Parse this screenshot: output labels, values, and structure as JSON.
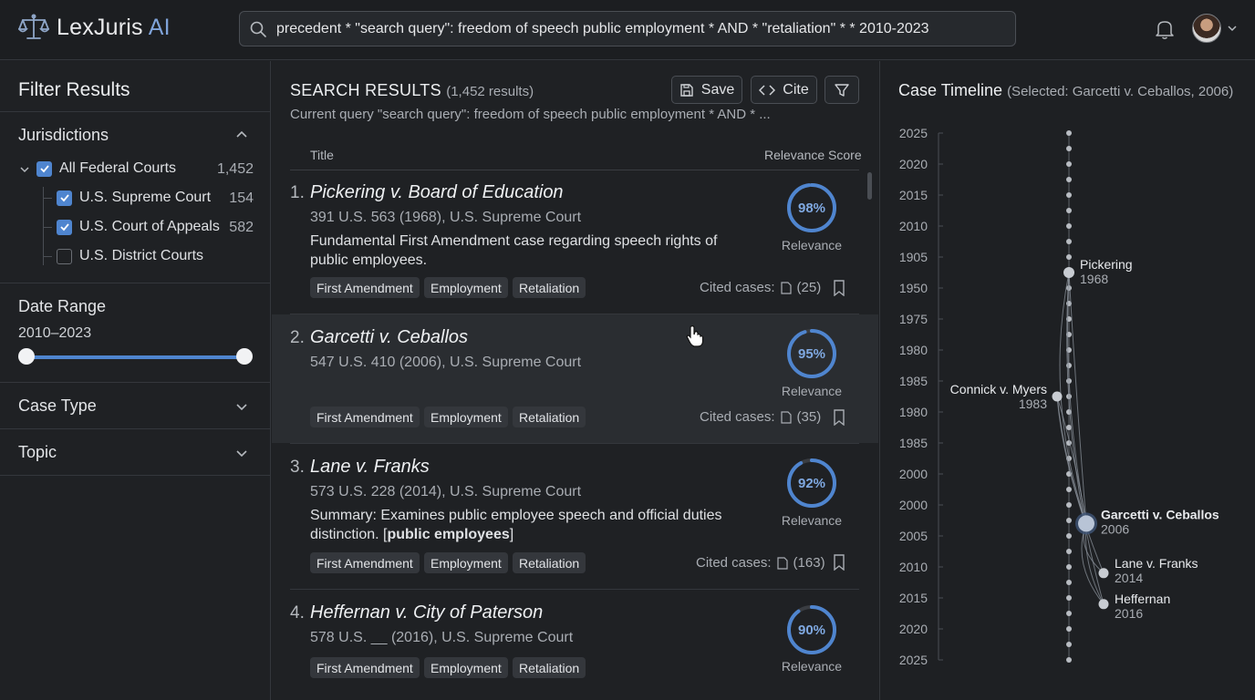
{
  "app": {
    "name": "LexJuris",
    "name_suffix": "AI"
  },
  "header": {
    "search_value": "precedent * \"search query\": freedom of speech public employment * AND * \"retaliation\" * * 2010-2023",
    "icons": [
      "search-icon",
      "bell-icon",
      "chevron-down-icon"
    ]
  },
  "sidebar": {
    "title": "Filter Results",
    "jurisdictions": {
      "label": "Jurisdictions",
      "items": [
        {
          "label": "All Federal Courts",
          "count": "1,452",
          "checked": true
        },
        {
          "label": "U.S. Supreme Court",
          "count": "154",
          "checked": true
        },
        {
          "label": "U.S. Court of Appeals",
          "count": "582",
          "checked": true
        },
        {
          "label": "U.S. District Courts",
          "count": "",
          "checked": false
        }
      ]
    },
    "date_range": {
      "label": "Date Range",
      "value": "2010–2023"
    },
    "case_type": {
      "label": "Case Type"
    },
    "topic": {
      "label": "Topic"
    }
  },
  "results": {
    "title": "SEARCH RESULTS",
    "count": "(1,452 results)",
    "query": "Current query \"search query\": freedom of speech public employment * AND * ...",
    "buttons": {
      "save": "Save",
      "cite": "Cite"
    },
    "columns": {
      "title": "Title",
      "score": "Relevance Score"
    },
    "score_label": "Relevance",
    "cited_label": "Cited cases:",
    "items": [
      {
        "num": "1.",
        "title": "Pickering v. Board of Education",
        "citation": "391 U.S. 563 (1968), U.S. Supreme Court",
        "summary": "Fundamental First Amendment case regarding speech rights of public employees.",
        "summary_bold": "",
        "summary_end": "",
        "tags": [
          "First Amendment",
          "Employment",
          "Retaliation"
        ],
        "cited": "(25)",
        "score": "98%",
        "score_value": 0.98
      },
      {
        "num": "2.",
        "title": "Garcetti v. Ceballos",
        "citation": "547 U.S. 410 (2006), U.S. Supreme Court",
        "summary": "",
        "summary_bold": "",
        "summary_end": "",
        "tags": [
          "First Amendment",
          "Employment",
          "Retaliation"
        ],
        "cited": "(35)",
        "score": "95%",
        "score_value": 0.95
      },
      {
        "num": "3.",
        "title": "Lane v. Franks",
        "citation": "573 U.S. 228 (2014), U.S. Supreme Court",
        "summary": "Summary: Examines public employee speech and official duties distinction. [",
        "summary_bold": "public employees",
        "summary_end": "]",
        "tags": [
          "First Amendment",
          "Employment",
          "Retaliation"
        ],
        "cited": "(163)",
        "score": "92%",
        "score_value": 0.92
      },
      {
        "num": "4.",
        "title": "Heffernan v. City of Paterson",
        "citation": "578 U.S. __ (2016), U.S. Supreme Court",
        "summary": "",
        "summary_bold": "",
        "summary_end": "",
        "tags": [
          "First Amendment",
          "Employment",
          "Retaliation"
        ],
        "cited": "",
        "score": "90%",
        "score_value": 0.9
      }
    ]
  },
  "timeline": {
    "title": "Case Timeline",
    "selected": "(Selected: Garcetti v. Ceballos, 2006)",
    "axis_labels": [
      "2025",
      "2020",
      "2015",
      "2010",
      "1905",
      "1950",
      "1975",
      "1980",
      "1985",
      "1980",
      "1985",
      "2000",
      "2000",
      "2005",
      "2010",
      "2015",
      "2020",
      "2025"
    ],
    "cases": [
      {
        "name": "Pickering",
        "year": "1968"
      },
      {
        "name": "Connick v. Myers",
        "year": "1983"
      },
      {
        "name": "Garcetti v. Ceballos",
        "year": "2006"
      },
      {
        "name": "Lane v. Franks",
        "year": "2014"
      },
      {
        "name": "Heffernan",
        "year": "2016"
      }
    ]
  },
  "colors": {
    "accent": "#4f85cf",
    "ring_track": "#3a3d42",
    "background": "#1e2023"
  }
}
